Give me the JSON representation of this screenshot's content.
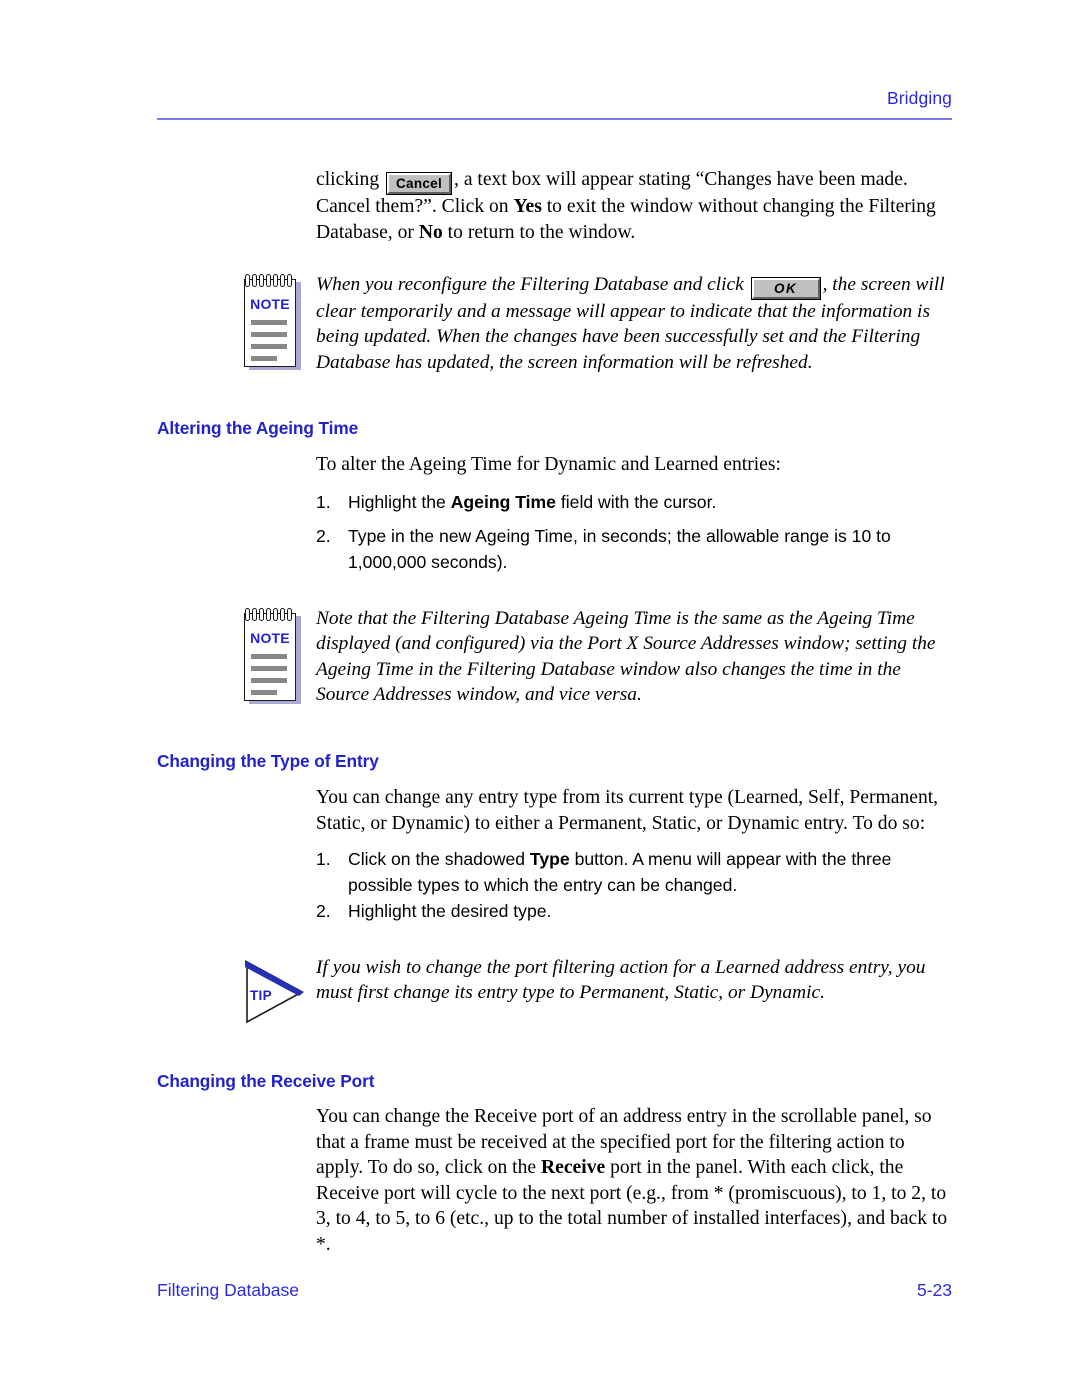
{
  "header": {
    "title": "Bridging"
  },
  "intro": {
    "line_prefix": "clicking ",
    "cancel_button_label": "Cancel",
    "line_rest": ", a text box will appear stating “Changes have been made. Cancel them?”. Click on ",
    "bold_yes": "Yes",
    "after_yes": " to exit the window without changing the Filtering Database, or ",
    "bold_no": "No",
    "after_no": " to return to the window."
  },
  "note1": {
    "badge": "NOTE",
    "text_before_button": "When you reconfigure the Filtering Database and click ",
    "ok_button_label": "OK",
    "text_after_button": ", the screen will clear temporarily and a message will appear to indicate that the information is being updated. When the changes have been successfully set and the Filtering Database has updated, the screen information will be refreshed."
  },
  "section1": {
    "heading": "Altering the Ageing Time",
    "intro": "To alter the Ageing Time for Dynamic and Learned entries:",
    "steps": [
      {
        "number": "1.",
        "pre": "Highlight the ",
        "bold": "Ageing Time",
        "post": " field with the cursor."
      },
      {
        "number": "2.",
        "pre": "Type in the new Ageing Time, in seconds; the allowable range is 10 to 1,000,000 seconds).",
        "bold": "",
        "post": ""
      }
    ]
  },
  "note2": {
    "badge": "NOTE",
    "text": "Note that the Filtering Database Ageing Time is the same as the Ageing Time displayed (and configured) via the Port X Source Addresses window; setting the Ageing Time in the Filtering Database window also changes the time in the Source Addresses window, and vice versa."
  },
  "section2": {
    "heading": "Changing the Type of Entry",
    "intro": "You can change any entry type from its current type (Learned, Self, Permanent, Static, or Dynamic) to either a Permanent, Static, or Dynamic entry. To do so:",
    "steps": [
      {
        "number": "1.",
        "pre": "Click on the shadowed ",
        "bold": "Type",
        "post": " button. A menu will appear with the three possible types to which the entry can be changed."
      },
      {
        "number": "2.",
        "pre": "Highlight the desired type.",
        "bold": "",
        "post": ""
      }
    ]
  },
  "tip": {
    "badge": "TIP",
    "text": "If you wish to change the port filtering action for a Learned address entry, you must first change its entry type to Permanent, Static, or Dynamic."
  },
  "section3": {
    "heading": "Changing the Receive Port",
    "pre": "You can change the Receive port of an address entry in the scrollable panel, so that a frame must be received at the specified port for the filtering action to apply. To do so, click on the ",
    "bold": "Receive",
    "post": " port in the panel. With each click, the Receive port will cycle to the next port (e.g., from * (promiscuous), to 1, to 2, to 3, to 4, to 5, to 6 (etc., up to the total number of installed interfaces), and back to *."
  },
  "footer": {
    "left": "Filtering Database",
    "right": "5-23"
  },
  "colors": {
    "heading_blue": "#2222cc",
    "header_blue": "#2a2ae0",
    "rule_blue": "#7b7be8",
    "note_shadow": "#a9a9d8",
    "note_line_gray": "#888888"
  }
}
